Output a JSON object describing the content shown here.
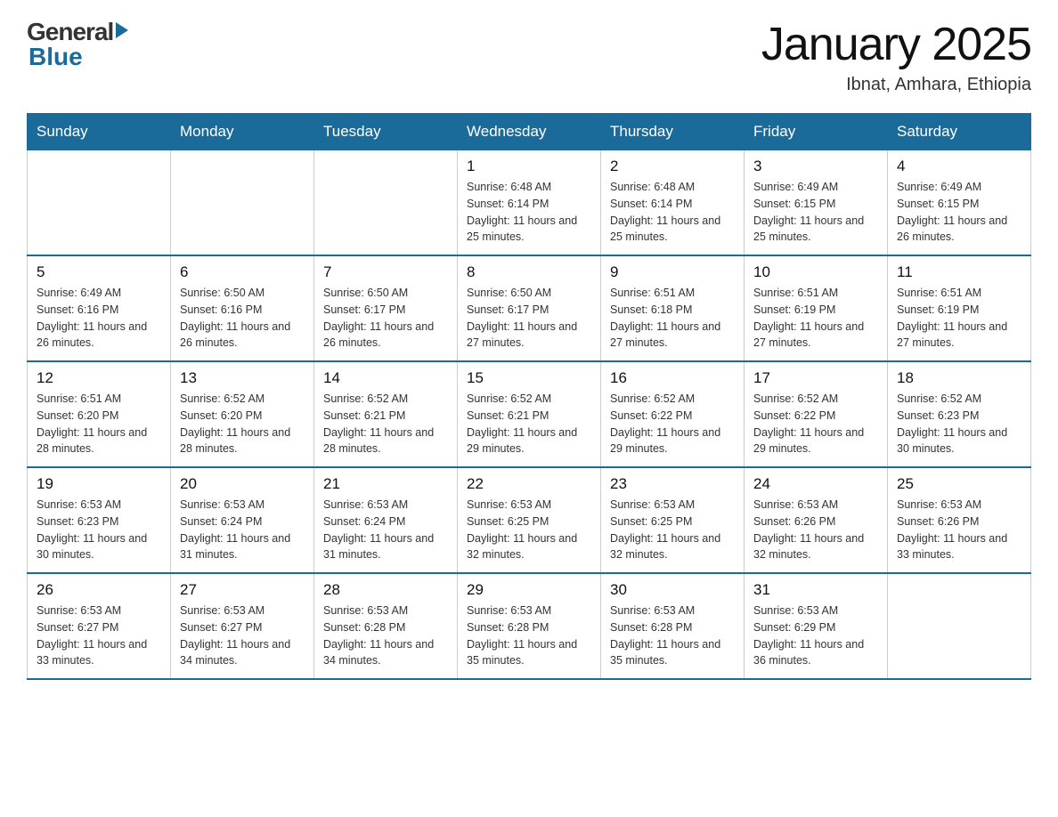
{
  "header": {
    "logo": {
      "general": "General",
      "blue": "Blue"
    },
    "title": "January 2025",
    "subtitle": "Ibnat, Amhara, Ethiopia"
  },
  "days_of_week": [
    "Sunday",
    "Monday",
    "Tuesday",
    "Wednesday",
    "Thursday",
    "Friday",
    "Saturday"
  ],
  "weeks": [
    [
      {
        "day": "",
        "info": ""
      },
      {
        "day": "",
        "info": ""
      },
      {
        "day": "",
        "info": ""
      },
      {
        "day": "1",
        "info": "Sunrise: 6:48 AM\nSunset: 6:14 PM\nDaylight: 11 hours\nand 25 minutes."
      },
      {
        "day": "2",
        "info": "Sunrise: 6:48 AM\nSunset: 6:14 PM\nDaylight: 11 hours\nand 25 minutes."
      },
      {
        "day": "3",
        "info": "Sunrise: 6:49 AM\nSunset: 6:15 PM\nDaylight: 11 hours\nand 25 minutes."
      },
      {
        "day": "4",
        "info": "Sunrise: 6:49 AM\nSunset: 6:15 PM\nDaylight: 11 hours\nand 26 minutes."
      }
    ],
    [
      {
        "day": "5",
        "info": "Sunrise: 6:49 AM\nSunset: 6:16 PM\nDaylight: 11 hours\nand 26 minutes."
      },
      {
        "day": "6",
        "info": "Sunrise: 6:50 AM\nSunset: 6:16 PM\nDaylight: 11 hours\nand 26 minutes."
      },
      {
        "day": "7",
        "info": "Sunrise: 6:50 AM\nSunset: 6:17 PM\nDaylight: 11 hours\nand 26 minutes."
      },
      {
        "day": "8",
        "info": "Sunrise: 6:50 AM\nSunset: 6:17 PM\nDaylight: 11 hours\nand 27 minutes."
      },
      {
        "day": "9",
        "info": "Sunrise: 6:51 AM\nSunset: 6:18 PM\nDaylight: 11 hours\nand 27 minutes."
      },
      {
        "day": "10",
        "info": "Sunrise: 6:51 AM\nSunset: 6:19 PM\nDaylight: 11 hours\nand 27 minutes."
      },
      {
        "day": "11",
        "info": "Sunrise: 6:51 AM\nSunset: 6:19 PM\nDaylight: 11 hours\nand 27 minutes."
      }
    ],
    [
      {
        "day": "12",
        "info": "Sunrise: 6:51 AM\nSunset: 6:20 PM\nDaylight: 11 hours\nand 28 minutes."
      },
      {
        "day": "13",
        "info": "Sunrise: 6:52 AM\nSunset: 6:20 PM\nDaylight: 11 hours\nand 28 minutes."
      },
      {
        "day": "14",
        "info": "Sunrise: 6:52 AM\nSunset: 6:21 PM\nDaylight: 11 hours\nand 28 minutes."
      },
      {
        "day": "15",
        "info": "Sunrise: 6:52 AM\nSunset: 6:21 PM\nDaylight: 11 hours\nand 29 minutes."
      },
      {
        "day": "16",
        "info": "Sunrise: 6:52 AM\nSunset: 6:22 PM\nDaylight: 11 hours\nand 29 minutes."
      },
      {
        "day": "17",
        "info": "Sunrise: 6:52 AM\nSunset: 6:22 PM\nDaylight: 11 hours\nand 29 minutes."
      },
      {
        "day": "18",
        "info": "Sunrise: 6:52 AM\nSunset: 6:23 PM\nDaylight: 11 hours\nand 30 minutes."
      }
    ],
    [
      {
        "day": "19",
        "info": "Sunrise: 6:53 AM\nSunset: 6:23 PM\nDaylight: 11 hours\nand 30 minutes."
      },
      {
        "day": "20",
        "info": "Sunrise: 6:53 AM\nSunset: 6:24 PM\nDaylight: 11 hours\nand 31 minutes."
      },
      {
        "day": "21",
        "info": "Sunrise: 6:53 AM\nSunset: 6:24 PM\nDaylight: 11 hours\nand 31 minutes."
      },
      {
        "day": "22",
        "info": "Sunrise: 6:53 AM\nSunset: 6:25 PM\nDaylight: 11 hours\nand 32 minutes."
      },
      {
        "day": "23",
        "info": "Sunrise: 6:53 AM\nSunset: 6:25 PM\nDaylight: 11 hours\nand 32 minutes."
      },
      {
        "day": "24",
        "info": "Sunrise: 6:53 AM\nSunset: 6:26 PM\nDaylight: 11 hours\nand 32 minutes."
      },
      {
        "day": "25",
        "info": "Sunrise: 6:53 AM\nSunset: 6:26 PM\nDaylight: 11 hours\nand 33 minutes."
      }
    ],
    [
      {
        "day": "26",
        "info": "Sunrise: 6:53 AM\nSunset: 6:27 PM\nDaylight: 11 hours\nand 33 minutes."
      },
      {
        "day": "27",
        "info": "Sunrise: 6:53 AM\nSunset: 6:27 PM\nDaylight: 11 hours\nand 34 minutes."
      },
      {
        "day": "28",
        "info": "Sunrise: 6:53 AM\nSunset: 6:28 PM\nDaylight: 11 hours\nand 34 minutes."
      },
      {
        "day": "29",
        "info": "Sunrise: 6:53 AM\nSunset: 6:28 PM\nDaylight: 11 hours\nand 35 minutes."
      },
      {
        "day": "30",
        "info": "Sunrise: 6:53 AM\nSunset: 6:28 PM\nDaylight: 11 hours\nand 35 minutes."
      },
      {
        "day": "31",
        "info": "Sunrise: 6:53 AM\nSunset: 6:29 PM\nDaylight: 11 hours\nand 36 minutes."
      },
      {
        "day": "",
        "info": ""
      }
    ]
  ]
}
